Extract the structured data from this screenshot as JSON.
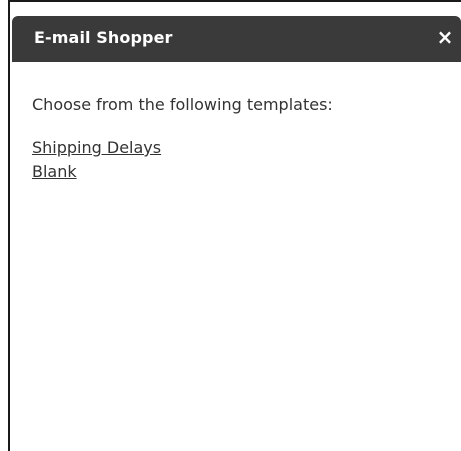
{
  "dialog": {
    "title": "E-mail Shopper",
    "close_icon": "close-icon",
    "close_glyph": "×"
  },
  "body": {
    "prompt": "Choose from the following templates:",
    "templates": [
      {
        "label": "Shipping Delays"
      },
      {
        "label": "Blank"
      }
    ]
  },
  "colors": {
    "titlebar_bg": "#3a3a3a",
    "titlebar_text": "#ffffff",
    "body_text": "#333333"
  }
}
